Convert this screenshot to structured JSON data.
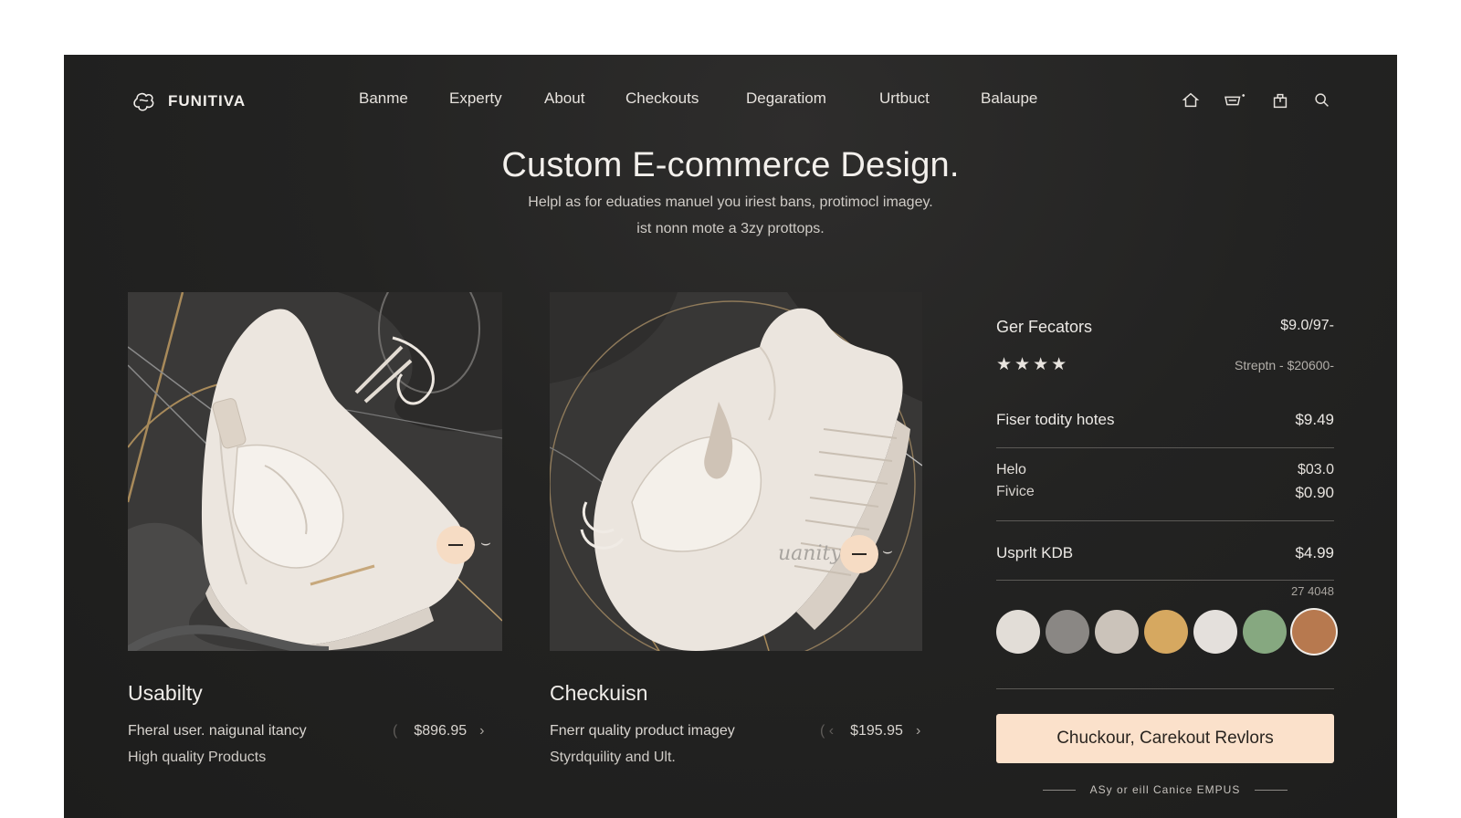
{
  "brand": {
    "name": "FUNITIVA",
    "logo_icon": "brand-logo-icon"
  },
  "nav": {
    "items": [
      "Banme",
      "Experty",
      "About",
      "Checkouts",
      "Degaratiom",
      "Urtbuct",
      "Balaupe"
    ],
    "icons": [
      "home-icon",
      "cart-icon",
      "bag-icon",
      "search-icon"
    ]
  },
  "hero": {
    "title": "Custom E-commerce Design.",
    "subtitle_line1": "Helpl as for eduaties manuel you iriest bans, protimocl imagey.",
    "subtitle_line2": "ist nonn mote a 3zy prottops."
  },
  "products": [
    {
      "title": "Usabilty",
      "line1": "Fheral user. naigunal itancy",
      "line2": "High quality Products",
      "price": "$896.95",
      "price_prefix": "(",
      "chevron": "›",
      "qty_tail": "⌣"
    },
    {
      "title": "Checkuisn",
      "line1": "Fnerr quality product imagey",
      "line2": "Styrdquility and Ult.",
      "price": "$195.95",
      "price_prefix": "( ‹",
      "chevron": "›",
      "qty_label": "uanity",
      "qty_tail": "⌣"
    }
  ],
  "summary": {
    "header_label": "Ger Fecators",
    "header_price": "$9.0/97-",
    "rating_stars": 4,
    "stars_text": "★★★★",
    "shipping_text": "Streptn - $20600-",
    "row1_label": "Fiser todity hotes",
    "row1_price": "$9.49",
    "row2a_label": "Helo",
    "row2a_price": "$03.0",
    "row2b_label": "Fivice",
    "row2b_price": "$0.90",
    "row3_label": "Usprlt KDB",
    "row3_price": "$4.99",
    "swatch_caption": "27 4048",
    "swatches": [
      "#e2ddd7",
      "#8a8784",
      "#cbc3ba",
      "#d6a860",
      "#e4e0dc",
      "#86a880",
      "#b7794f"
    ],
    "selected_swatch": 6,
    "cta_label": "Chuckour, Carekout Revlors",
    "footnote": "ASy or eill Canice EMPUS"
  }
}
